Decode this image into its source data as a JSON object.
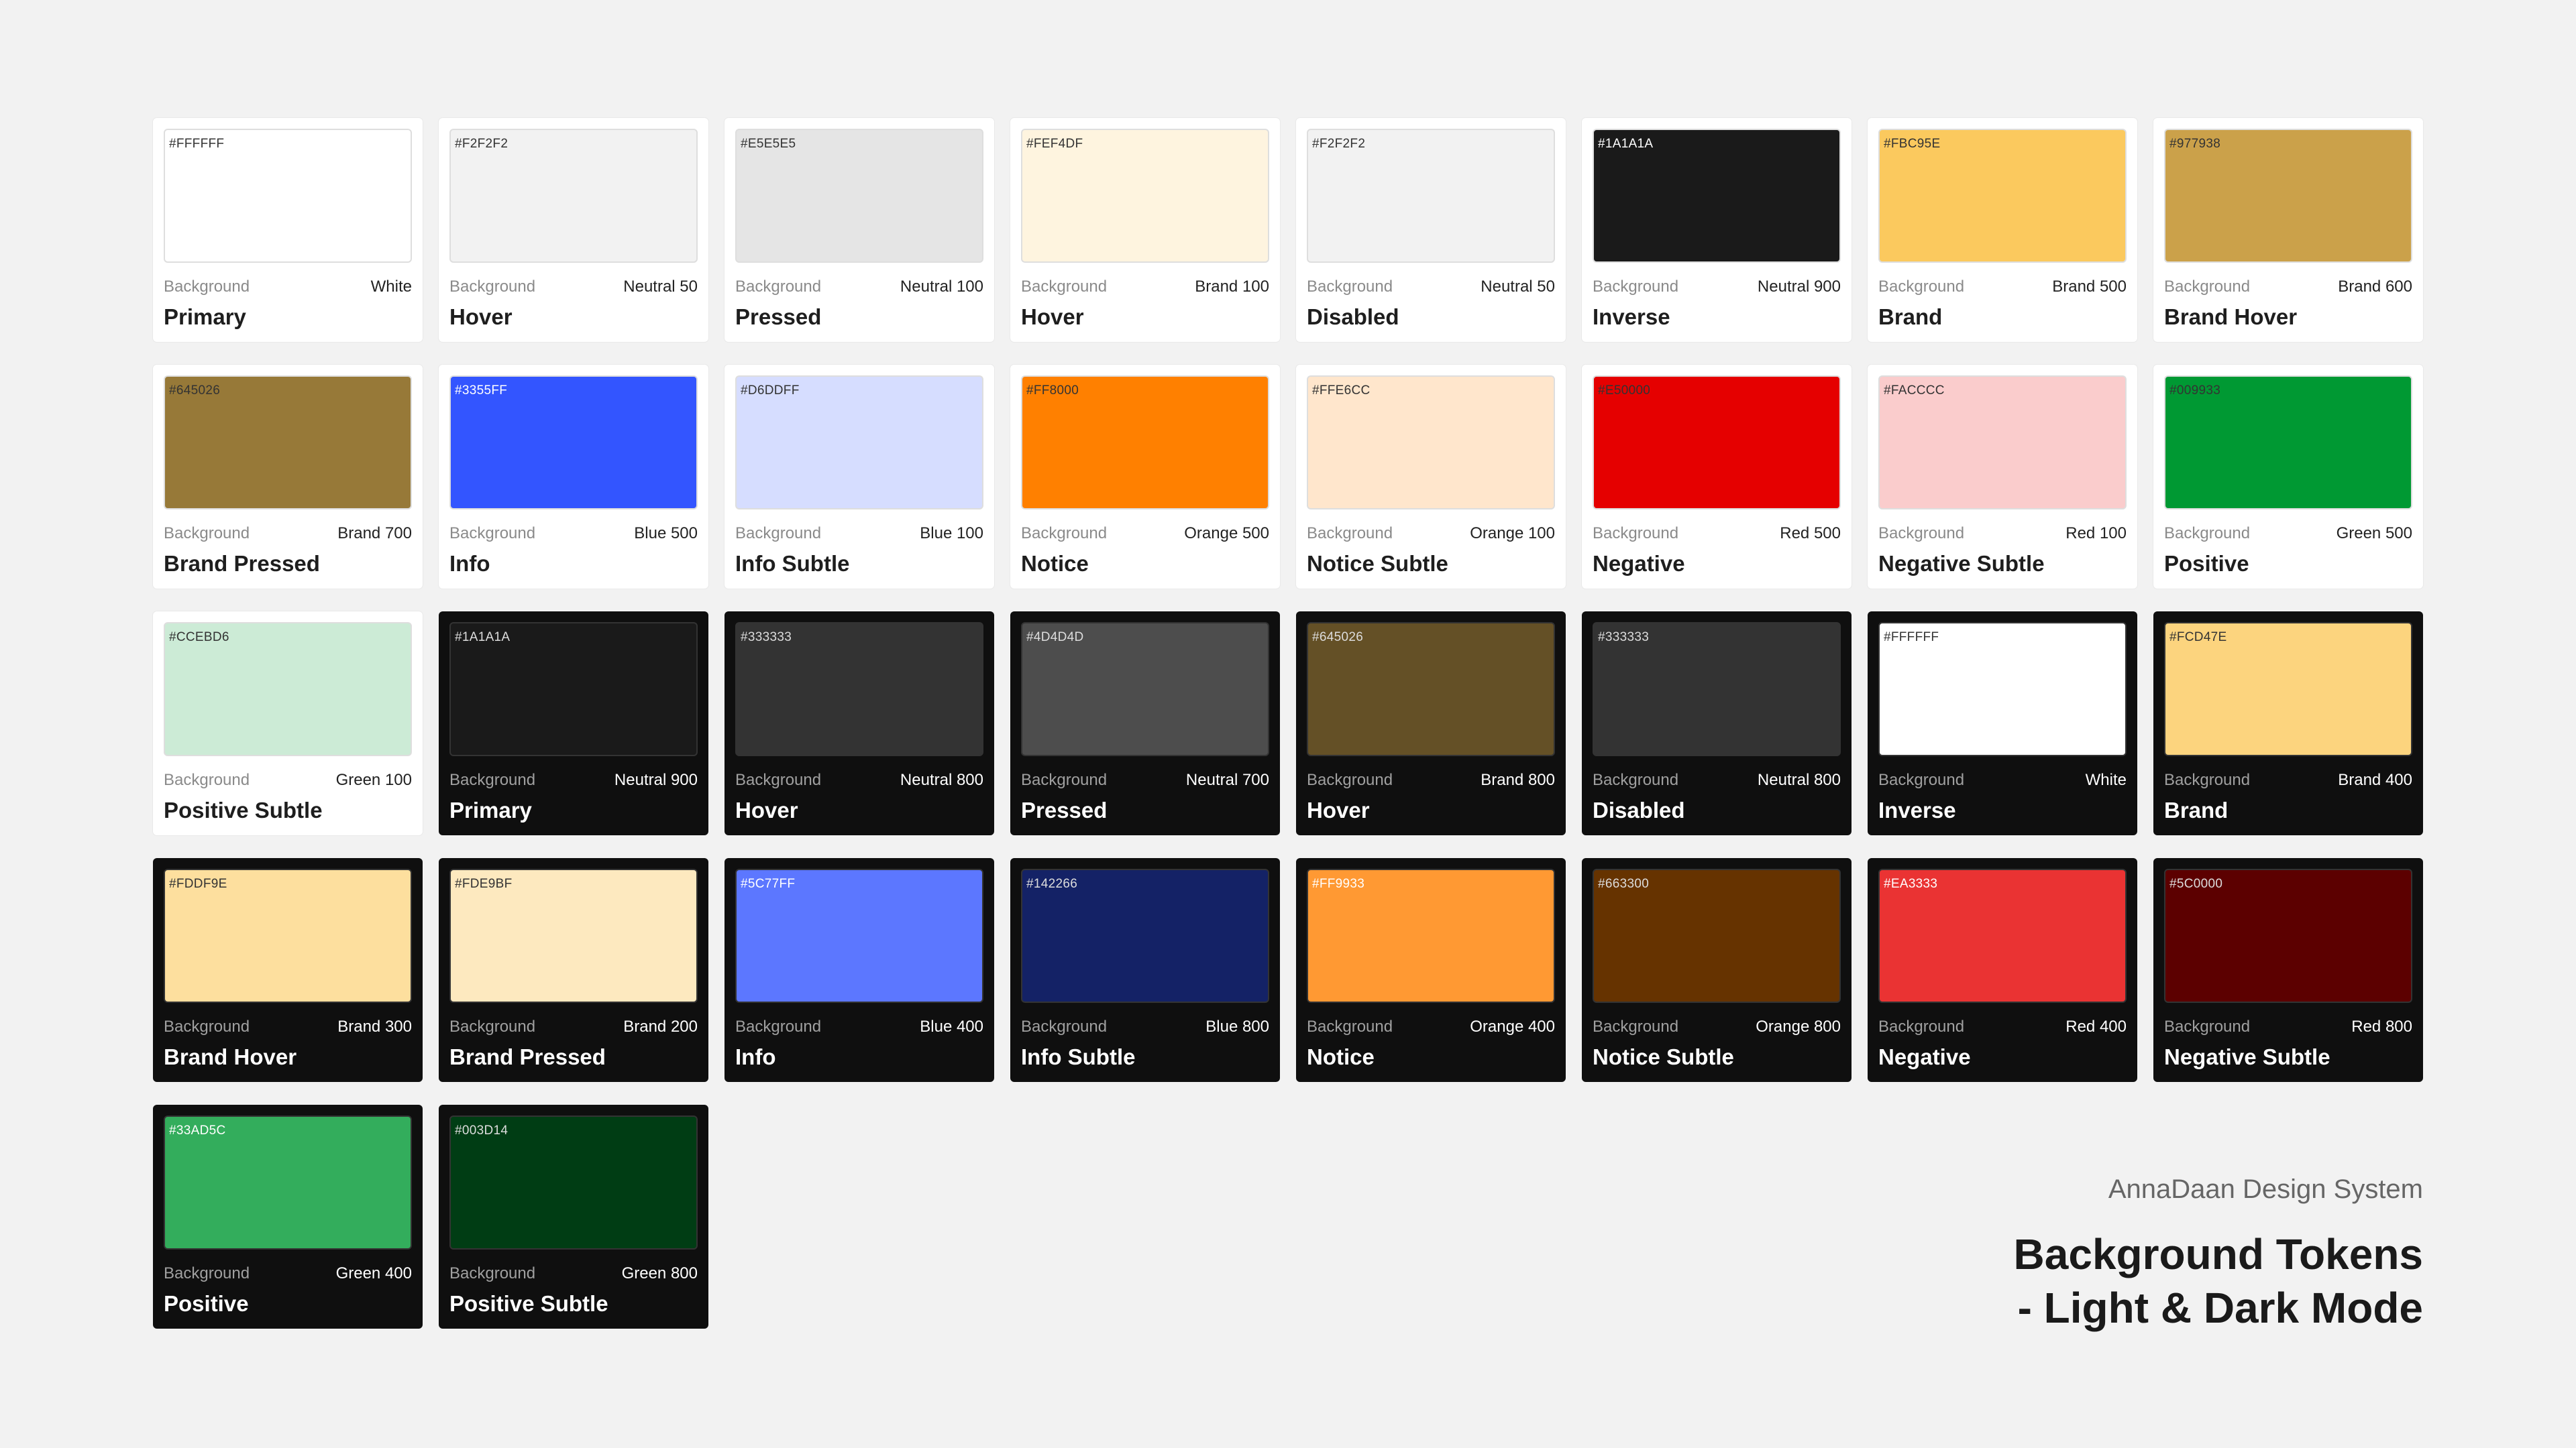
{
  "footer": {
    "system": "AnnaDaan Design System",
    "title_line1": "Background Tokens",
    "title_line2": "- Light & Dark Mode"
  },
  "tokens": [
    {
      "mode": "light",
      "hex": "#FFFFFF",
      "hex_label": "#FFFFFF",
      "category": "Background",
      "scale": "White",
      "name": "Primary",
      "label_color": "#333333"
    },
    {
      "mode": "light",
      "hex": "#F2F2F2",
      "hex_label": "#F2F2F2",
      "category": "Background",
      "scale": "Neutral 50",
      "name": "Hover",
      "label_color": "#333333"
    },
    {
      "mode": "light",
      "hex": "#E5E5E5",
      "hex_label": "#E5E5E5",
      "category": "Background",
      "scale": "Neutral 100",
      "name": "Pressed",
      "label_color": "#333333"
    },
    {
      "mode": "light",
      "hex": "#FEF4DF",
      "hex_label": "#FEF4DF",
      "category": "Background",
      "scale": "Brand 100",
      "name": "Hover",
      "label_color": "#333333"
    },
    {
      "mode": "light",
      "hex": "#F2F2F2",
      "hex_label": "#F2F2F2",
      "category": "Background",
      "scale": "Neutral 50",
      "name": "Disabled",
      "label_color": "#333333"
    },
    {
      "mode": "light",
      "hex": "#1A1A1A",
      "hex_label": "#1A1A1A",
      "category": "Background",
      "scale": "Neutral 900",
      "name": "Inverse",
      "label_color": "#ffffff"
    },
    {
      "mode": "light",
      "hex": "#FBC95E",
      "hex_label": "#FBC95E",
      "category": "Background",
      "scale": "Brand 500",
      "name": "Brand",
      "label_color": "#333333"
    },
    {
      "mode": "light",
      "hex": "#CBA14A",
      "hex_label": "#977938",
      "category": "Background",
      "scale": "Brand 600",
      "name": "Brand Hover",
      "label_color": "#333333"
    },
    {
      "mode": "light",
      "hex": "#977938",
      "hex_label": "#645026",
      "category": "Background",
      "scale": "Brand 700",
      "name": "Brand Pressed",
      "label_color": "#333333"
    },
    {
      "mode": "light",
      "hex": "#3355FF",
      "hex_label": "#3355FF",
      "category": "Background",
      "scale": "Blue 500",
      "name": "Info",
      "label_color": "#ffffff"
    },
    {
      "mode": "light",
      "hex": "#D6DDFF",
      "hex_label": "#D6DDFF",
      "category": "Background",
      "scale": "Blue 100",
      "name": "Info Subtle",
      "label_color": "#333333"
    },
    {
      "mode": "light",
      "hex": "#FF8000",
      "hex_label": "#FF8000",
      "category": "Background",
      "scale": "Orange 500",
      "name": "Notice",
      "label_color": "#333333"
    },
    {
      "mode": "light",
      "hex": "#FFE6CC",
      "hex_label": "#FFE6CC",
      "category": "Background",
      "scale": "Orange 100",
      "name": "Notice Subtle",
      "label_color": "#333333"
    },
    {
      "mode": "light",
      "hex": "#E50000",
      "hex_label": "#E50000",
      "category": "Background",
      "scale": "Red 500",
      "name": "Negative",
      "label_color": "#333333"
    },
    {
      "mode": "light",
      "hex": "#FACCCC",
      "hex_label": "#FACCCC",
      "category": "Background",
      "scale": "Red 100",
      "name": "Negative Subtle",
      "label_color": "#333333"
    },
    {
      "mode": "light",
      "hex": "#009933",
      "hex_label": "#009933",
      "category": "Background",
      "scale": "Green 500",
      "name": "Positive",
      "label_color": "#333333"
    },
    {
      "mode": "light",
      "hex": "#CCEBD6",
      "hex_label": "#CCEBD6",
      "category": "Background",
      "scale": "Green 100",
      "name": "Positive Subtle",
      "label_color": "#333333"
    },
    {
      "mode": "dark",
      "hex": "#1A1A1A",
      "hex_label": "#1A1A1A",
      "category": "Background",
      "scale": "Neutral 900",
      "name": "Primary",
      "label_color": "#dddddd"
    },
    {
      "mode": "dark",
      "hex": "#333333",
      "hex_label": "#333333",
      "category": "Background",
      "scale": "Neutral 800",
      "name": "Hover",
      "label_color": "#dddddd"
    },
    {
      "mode": "dark",
      "hex": "#4D4D4D",
      "hex_label": "#4D4D4D",
      "category": "Background",
      "scale": "Neutral 700",
      "name": "Pressed",
      "label_color": "#dddddd"
    },
    {
      "mode": "dark",
      "hex": "#645026",
      "hex_label": "#645026",
      "category": "Background",
      "scale": "Brand 800",
      "name": "Hover",
      "label_color": "#dddddd"
    },
    {
      "mode": "dark",
      "hex": "#333333",
      "hex_label": "#333333",
      "category": "Background",
      "scale": "Neutral 800",
      "name": "Disabled",
      "label_color": "#dddddd"
    },
    {
      "mode": "dark",
      "hex": "#FFFFFF",
      "hex_label": "#FFFFFF",
      "category": "Background",
      "scale": "White",
      "name": "Inverse",
      "label_color": "#333333"
    },
    {
      "mode": "dark",
      "hex": "#FCD47E",
      "hex_label": "#FCD47E",
      "category": "Background",
      "scale": "Brand 400",
      "name": "Brand",
      "label_color": "#333333"
    },
    {
      "mode": "dark",
      "hex": "#FDDF9E",
      "hex_label": "#FDDF9E",
      "category": "Background",
      "scale": "Brand 300",
      "name": "Brand Hover",
      "label_color": "#333333"
    },
    {
      "mode": "dark",
      "hex": "#FDE9BF",
      "hex_label": "#FDE9BF",
      "category": "Background",
      "scale": "Brand 200",
      "name": "Brand Pressed",
      "label_color": "#333333"
    },
    {
      "mode": "dark",
      "hex": "#5C77FF",
      "hex_label": "#5C77FF",
      "category": "Background",
      "scale": "Blue 400",
      "name": "Info",
      "label_color": "#ffffff"
    },
    {
      "mode": "dark",
      "hex": "#142266",
      "hex_label": "#142266",
      "category": "Background",
      "scale": "Blue 800",
      "name": "Info Subtle",
      "label_color": "#dddddd"
    },
    {
      "mode": "dark",
      "hex": "#FF9933",
      "hex_label": "#FF9933",
      "category": "Background",
      "scale": "Orange 400",
      "name": "Notice",
      "label_color": "#ffffff"
    },
    {
      "mode": "dark",
      "hex": "#663300",
      "hex_label": "#663300",
      "category": "Background",
      "scale": "Orange 800",
      "name": "Notice Subtle",
      "label_color": "#dddddd"
    },
    {
      "mode": "dark",
      "hex": "#EA3333",
      "hex_label": "#EA3333",
      "category": "Background",
      "scale": "Red 400",
      "name": "Negative",
      "label_color": "#ffffff"
    },
    {
      "mode": "dark",
      "hex": "#5C0000",
      "hex_label": "#5C0000",
      "category": "Background",
      "scale": "Red 800",
      "name": "Negative Subtle",
      "label_color": "#dddddd"
    },
    {
      "mode": "dark",
      "hex": "#33AD5C",
      "hex_label": "#33AD5C",
      "category": "Background",
      "scale": "Green 400",
      "name": "Positive",
      "label_color": "#ffffff"
    },
    {
      "mode": "dark",
      "hex": "#003D14",
      "hex_label": "#003D14",
      "category": "Background",
      "scale": "Green 800",
      "name": "Positive Subtle",
      "label_color": "#dddddd"
    }
  ]
}
